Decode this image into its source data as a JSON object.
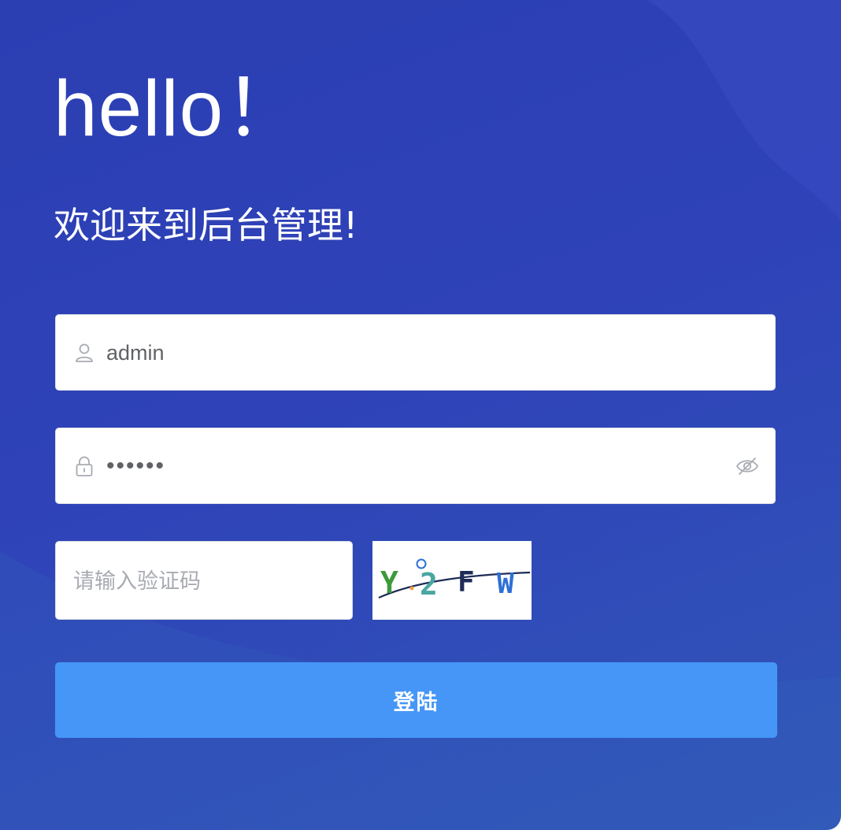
{
  "header": {
    "hello": "hello！",
    "welcome": "欢迎来到后台管理!"
  },
  "form": {
    "username": {
      "value": "admin",
      "icon": "user-icon"
    },
    "password": {
      "value": "••••••",
      "icon": "lock-icon",
      "toggle_icon": "eye-off-icon"
    },
    "captcha": {
      "placeholder": "请输入验证码",
      "code_text": "Y.2FW"
    },
    "login_label": "登陆"
  },
  "colors": {
    "panel_bg": "#2f42b8",
    "button_bg": "#4596f7",
    "captcha_y": "#3d9a3a",
    "captcha_2": "#4aa6a0",
    "captcha_f": "#1e2b57",
    "captcha_w": "#2f6fd6"
  }
}
